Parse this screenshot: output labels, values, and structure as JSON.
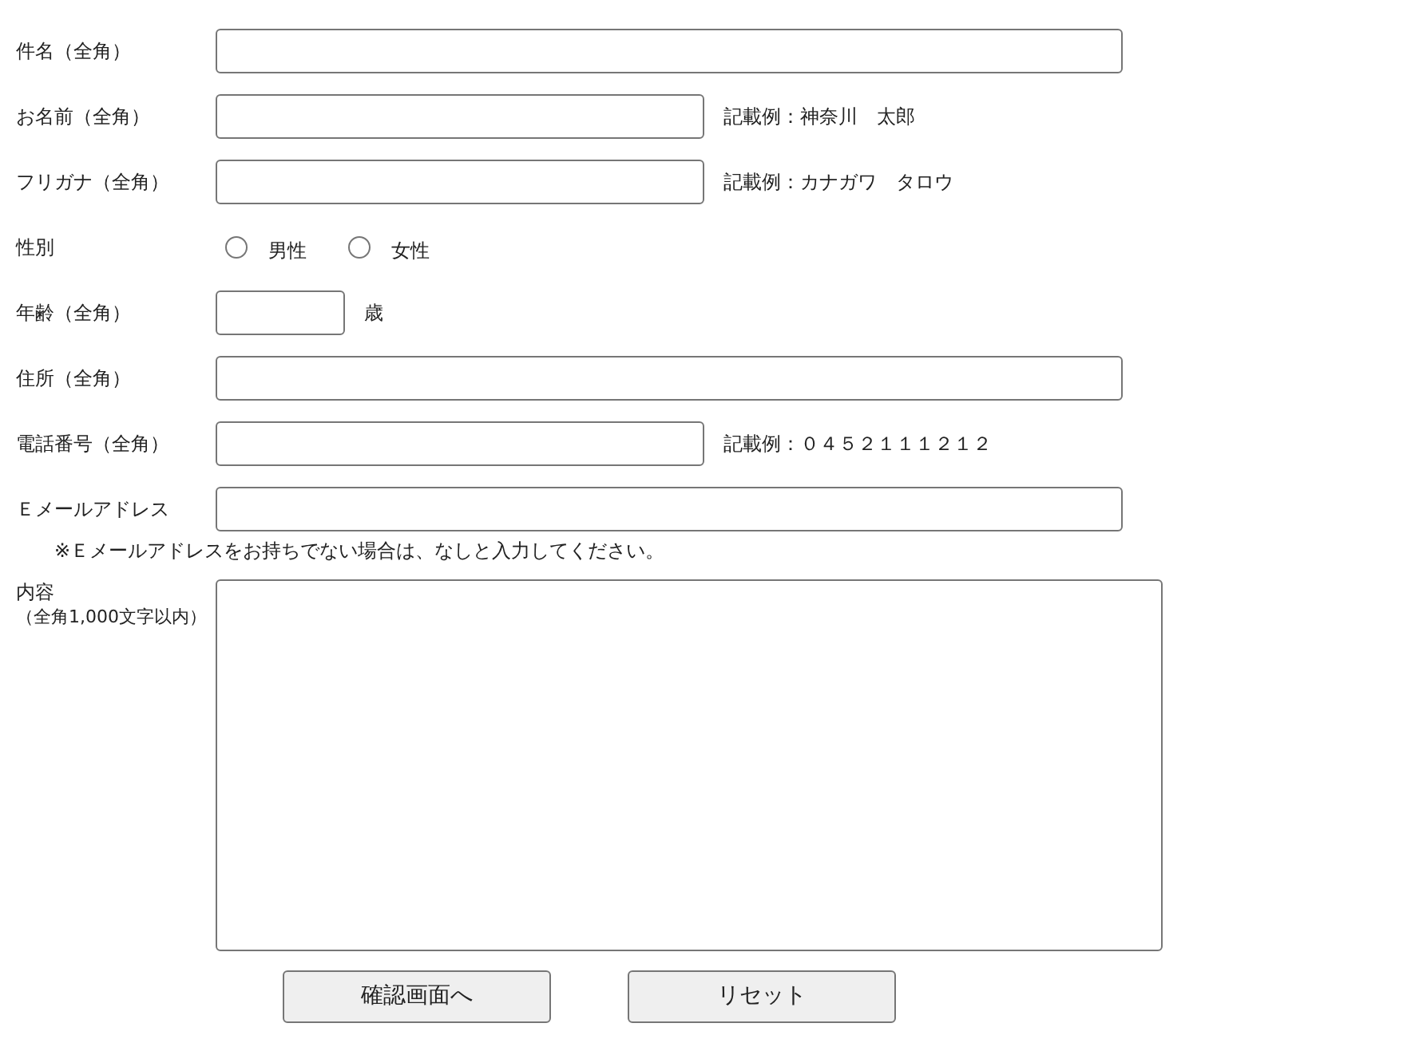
{
  "fields": [
    {
      "kind": "wide",
      "label": "件名（全角）"
    },
    {
      "kind": "medium",
      "label": "お名前（全角）",
      "note": "記載例：神奈川　太郎"
    },
    {
      "kind": "medium",
      "label": "フリガナ（全角）",
      "note": "記載例：カナガワ　タロウ"
    },
    {
      "kind": "radio",
      "label": "性別",
      "options": [
        {
          "label": "男性",
          "selected": false
        },
        {
          "label": "女性",
          "selected": false
        }
      ]
    },
    {
      "kind": "short",
      "label": "年齢（全角）",
      "note": "歳"
    },
    {
      "kind": "wide",
      "label": "住所（全角）"
    },
    {
      "kind": "medium",
      "label": "電話番号（全角）",
      "note": "記載例：０４５２１１１２１２"
    },
    {
      "kind": "wide",
      "label": "Ｅメールアドレス",
      "hint": "※Ｅメールアドレスをお持ちでない場合は、なしと入力してください。"
    },
    {
      "kind": "textarea",
      "label": "内容",
      "sublabel": "（全角1,000文字以内）"
    }
  ],
  "buttons": [
    "確認画面へ",
    "リセット"
  ]
}
